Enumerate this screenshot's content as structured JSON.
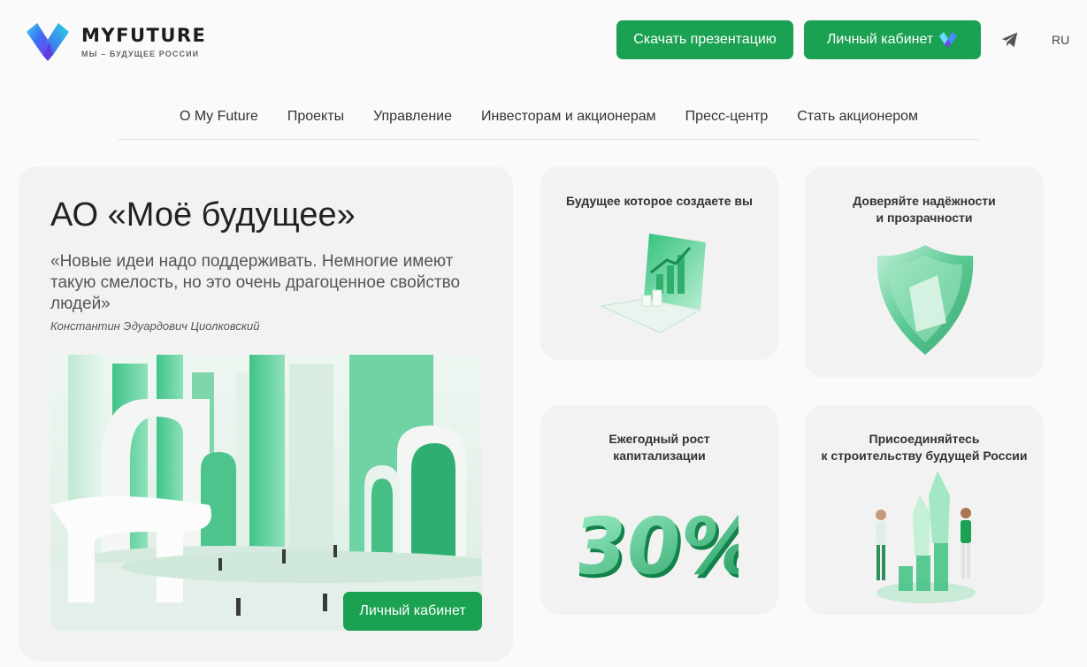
{
  "header": {
    "logo_name": "MYFUTURE",
    "logo_tagline": "МЫ – БУДУЩЕЕ РОССИИ",
    "download_button": "Скачать презентацию",
    "cabinet_button": "Личный кабинет",
    "language": "RU"
  },
  "nav": {
    "items": [
      {
        "label": "О My Future"
      },
      {
        "label": "Проекты"
      },
      {
        "label": "Управление"
      },
      {
        "label": "Инвесторам и акционерам"
      },
      {
        "label": "Пресс-центр"
      },
      {
        "label": "Стать акционером"
      }
    ]
  },
  "main": {
    "title": "АО «Моё будущее»",
    "quote": "«Новые идеи надо поддерживать. Немногие имеют такую смелость, но это очень драгоценное свойство людей»",
    "author": "Константин Эдуардович Циолковский",
    "cabinet_button": "Личный кабинет"
  },
  "cards": [
    {
      "title": "Будущее которое создаете вы"
    },
    {
      "title": "Доверяйте надёжности\nи прозрачности"
    },
    {
      "title": "Ежегодный рост\nкапитализации",
      "figure": "30%"
    },
    {
      "title": "Присоединяйтесь\nк строительству будущей России"
    }
  ],
  "colors": {
    "accent": "#1aa152",
    "background": "#fafafa",
    "card": "#f2f2f2"
  }
}
